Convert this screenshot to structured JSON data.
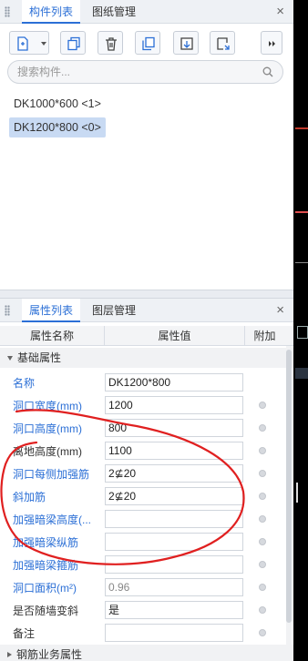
{
  "top_panel": {
    "tabs": [
      {
        "label": "构件列表",
        "active": true
      },
      {
        "label": "图纸管理",
        "active": false
      }
    ],
    "close_glyph": "×",
    "toolbar": [
      "new-component-icon",
      "copy-icon",
      "delete-icon",
      "layer-copy-icon",
      "export-icon",
      "import-icon",
      "more-icon"
    ],
    "search": {
      "placeholder": "搜索构件...",
      "value": ""
    },
    "components": [
      {
        "label": "DK1000*600  <1>",
        "selected": false
      },
      {
        "label": "DK1200*800  <0>",
        "selected": true
      }
    ]
  },
  "bottom_panel": {
    "tabs": [
      {
        "label": "属性列表",
        "active": true
      },
      {
        "label": "图层管理",
        "active": false
      }
    ],
    "close_glyph": "×",
    "columns": [
      "属性名称",
      "属性值",
      "附加"
    ],
    "group_basic": "基础属性",
    "group_rebar": "钢筋业务属性",
    "properties": [
      {
        "name": "名称",
        "value": "DK1200*800",
        "color": "blue",
        "dot": false,
        "readonly": false
      },
      {
        "name": "洞口宽度(mm)",
        "value": "1200",
        "color": "blue",
        "dot": true,
        "readonly": false
      },
      {
        "name": "洞口高度(mm)",
        "value": "800",
        "color": "blue",
        "dot": true,
        "readonly": false
      },
      {
        "name": "离地高度(mm)",
        "value": "1100",
        "color": "dark",
        "dot": true,
        "readonly": false
      },
      {
        "name": "洞口每侧加强筋",
        "value": "2⊈20",
        "color": "blue",
        "dot": true,
        "readonly": false
      },
      {
        "name": "斜加筋",
        "value": "2⊈20",
        "color": "blue",
        "dot": true,
        "readonly": false
      },
      {
        "name": "加强暗梁高度(...",
        "value": "",
        "color": "blue",
        "dot": true,
        "readonly": false
      },
      {
        "name": "加强暗梁纵筋",
        "value": "",
        "color": "blue",
        "dot": true,
        "readonly": false
      },
      {
        "name": "加强暗梁箍筋",
        "value": "",
        "color": "blue",
        "dot": true,
        "readonly": false
      },
      {
        "name": "洞口面积(m²)",
        "value": "0.96",
        "color": "blue",
        "dot": true,
        "readonly": true
      },
      {
        "name": "是否随墙变斜",
        "value": "是",
        "color": "dark",
        "dot": true,
        "readonly": false
      },
      {
        "name": "备注",
        "value": "",
        "color": "dark",
        "dot": true,
        "readonly": false
      }
    ]
  },
  "colors": {
    "accent": "#2b6fd6",
    "annotation": "#e02020",
    "selected_bg": "#c8daf3"
  }
}
